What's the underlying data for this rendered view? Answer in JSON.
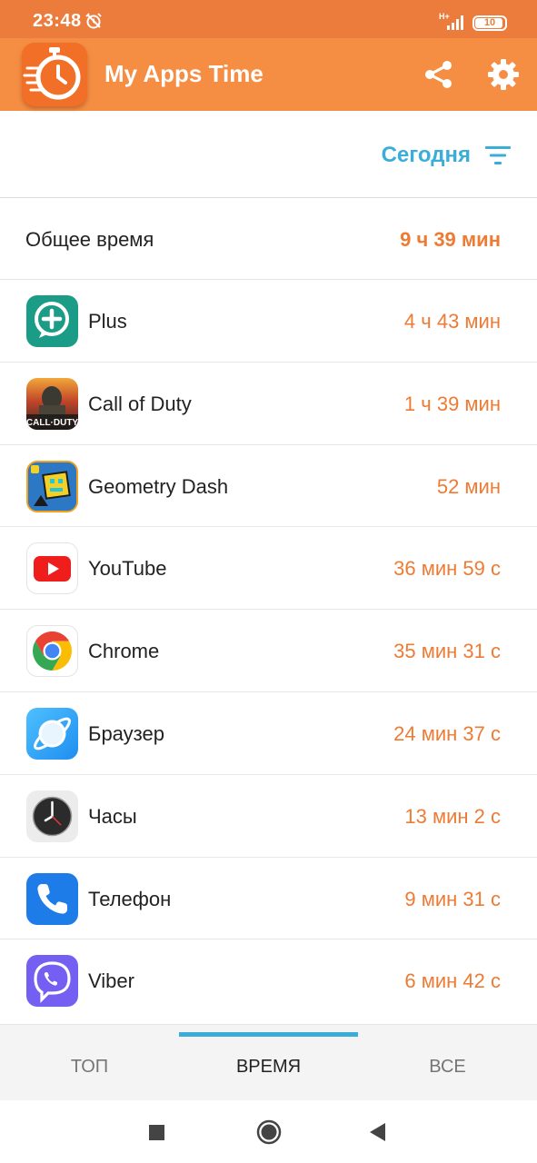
{
  "status_bar": {
    "time": "23:48",
    "network": "H+",
    "battery": "10"
  },
  "app_bar": {
    "title": "My Apps Time"
  },
  "filter": {
    "label": "Сегодня"
  },
  "total": {
    "label": "Общее время",
    "value": "9 ч 39 мин"
  },
  "apps": [
    {
      "name": "Plus",
      "time": "4 ч 43 мин",
      "icon": "plus-app-icon"
    },
    {
      "name": "Call of Duty",
      "time": "1 ч 39 мин",
      "icon": "call-of-duty-app-icon"
    },
    {
      "name": "Geometry Dash",
      "time": "52 мин",
      "icon": "geometry-dash-app-icon"
    },
    {
      "name": "YouTube",
      "time": "36 мин 59 с",
      "icon": "youtube-app-icon"
    },
    {
      "name": "Chrome",
      "time": "35 мин 31 с",
      "icon": "chrome-app-icon"
    },
    {
      "name": "Браузер",
      "time": "24 мин 37 с",
      "icon": "browser-app-icon"
    },
    {
      "name": "Часы",
      "time": "13 мин 2 с",
      "icon": "clock-app-icon"
    },
    {
      "name": "Телефон",
      "time": "9 мин 31 с",
      "icon": "phone-app-icon"
    },
    {
      "name": "Viber",
      "time": "6 мин 42 с",
      "icon": "viber-app-icon"
    }
  ],
  "tabs": [
    {
      "label": "ТОП"
    },
    {
      "label": "ВРЕМЯ"
    },
    {
      "label": "ВСЕ"
    }
  ],
  "colors": {
    "status_bar": "#ec7c3c",
    "app_bar": "#f58d43",
    "accent_time": "#ee7b34",
    "accent_blue": "#3aaed8"
  }
}
